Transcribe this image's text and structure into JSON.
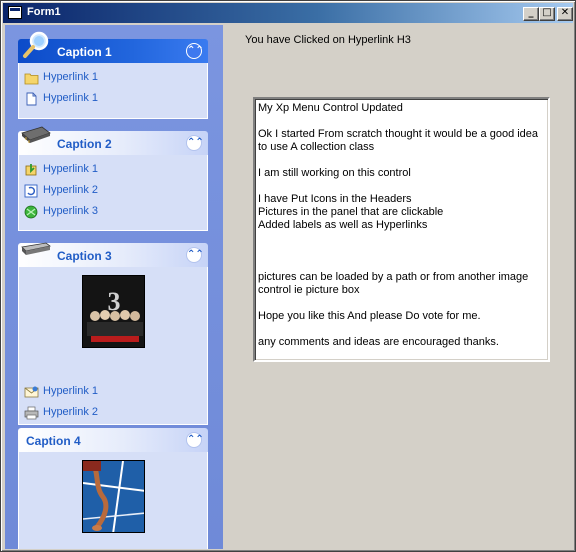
{
  "window": {
    "title": "Form1",
    "controls": {
      "minimize": "_",
      "maximize": "□",
      "close": "✕"
    }
  },
  "sidebar": {
    "panels": [
      {
        "caption": "Caption 1",
        "style": "dark",
        "head_icon": "magnifier-icon",
        "chevron": "⌃⌃",
        "links": [
          {
            "label": "Hyperlink 1",
            "icon": "folder-icon"
          },
          {
            "label": "Hyperlink 1",
            "icon": "document-icon"
          }
        ]
      },
      {
        "caption": "Caption 2",
        "style": "light",
        "head_icon": "memory-chip-icon",
        "chevron": "⌃⌃",
        "links": [
          {
            "label": "Hyperlink 1",
            "icon": "install-icon"
          },
          {
            "label": "Hyperlink 2",
            "icon": "refresh-icon"
          },
          {
            "label": "Hyperlink 3",
            "icon": "green-orb-icon"
          }
        ]
      },
      {
        "caption": "Caption 3",
        "style": "light",
        "head_icon": "drive-icon",
        "chevron": "⌃⌃",
        "picture": "scream-3-poster",
        "links": [
          {
            "label": "Hyperlink 1",
            "icon": "mail-icon"
          },
          {
            "label": "Hyperlink 2",
            "icon": "printer-icon"
          }
        ]
      },
      {
        "caption": "Caption 4",
        "style": "light",
        "chevron": "⌃⌃",
        "picture": "tennis-court-photo"
      }
    ]
  },
  "main": {
    "status": "You have Clicked on Hyperlink H3",
    "textbox_lines": [
      "My Xp Menu Control Updated",
      "",
      "Ok I started From scratch thought it would be a good idea to use A collection class",
      "",
      "I am still working on this control",
      "",
      "I have Put Icons in the Headers",
      "Pictures in the panel that are clickable",
      "Added labels as well as Hyperlinks",
      "",
      "",
      "",
      "pictures can be loaded by a path or from another image control ie picture box",
      "",
      "Hope you like this And please Do vote for me.",
      "",
      "any comments and ideas are encouraged thanks."
    ]
  },
  "colors": {
    "sidebar_bg": "#7b95e0",
    "panel_body": "#d6dff7",
    "link": "#215dc6",
    "dark_header": "#0c4bc9",
    "window_bg": "#d4d0c8",
    "titlebar": "#0a246a"
  }
}
